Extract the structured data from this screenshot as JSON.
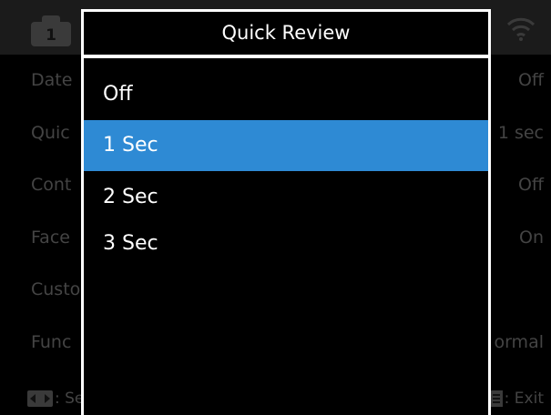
{
  "background": {
    "tab_number": "1",
    "rows": [
      {
        "label": "Date",
        "value": "Off"
      },
      {
        "label": "Quic",
        "value": "1 sec"
      },
      {
        "label": "Cont",
        "value": "Off"
      },
      {
        "label": "Face",
        "value": "On"
      },
      {
        "label": "Custo",
        "value": ""
      },
      {
        "label": "Func",
        "value": "ormal"
      }
    ],
    "footer": {
      "left_label": ": Se",
      "right_label": ": Exit"
    }
  },
  "dialog": {
    "title": "Quick Review",
    "selected_index": 1,
    "options": [
      "Off",
      "1 Sec",
      "2 Sec",
      "3 Sec"
    ]
  },
  "colors": {
    "highlight": "#2e8ad4",
    "dimmed_text": "#444444",
    "dialog_border": "#ffffff"
  }
}
